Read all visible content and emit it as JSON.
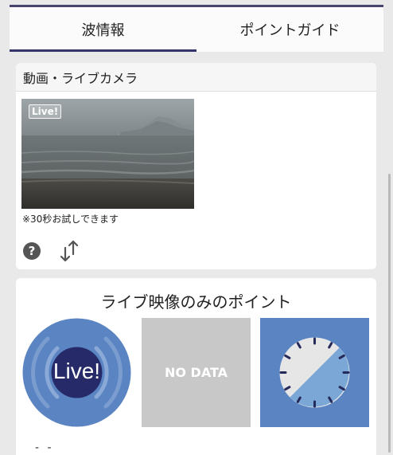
{
  "tabs": [
    {
      "label": "波情報",
      "active": true
    },
    {
      "label": "ポイントガイド",
      "active": false
    }
  ],
  "video_section": {
    "title": "動画・ライブカメラ",
    "live_tag": "Live!",
    "trial_note": "※30秒お試しできます",
    "icons": [
      "help-icon",
      "sort-arrows-icon"
    ]
  },
  "points_section": {
    "title": "ライブ映像のみのポイント",
    "tiles": [
      {
        "label": "Live!",
        "icon": "live-broadcast-icon"
      },
      {
        "label": "NO DATA"
      },
      {
        "icon": "clock-icon"
      }
    ],
    "footer_text": "- -"
  },
  "colors": {
    "tab_indicator": "#34346a",
    "tile_blue": "#5a84c2",
    "nodata_gray": "#c8c8c8"
  }
}
